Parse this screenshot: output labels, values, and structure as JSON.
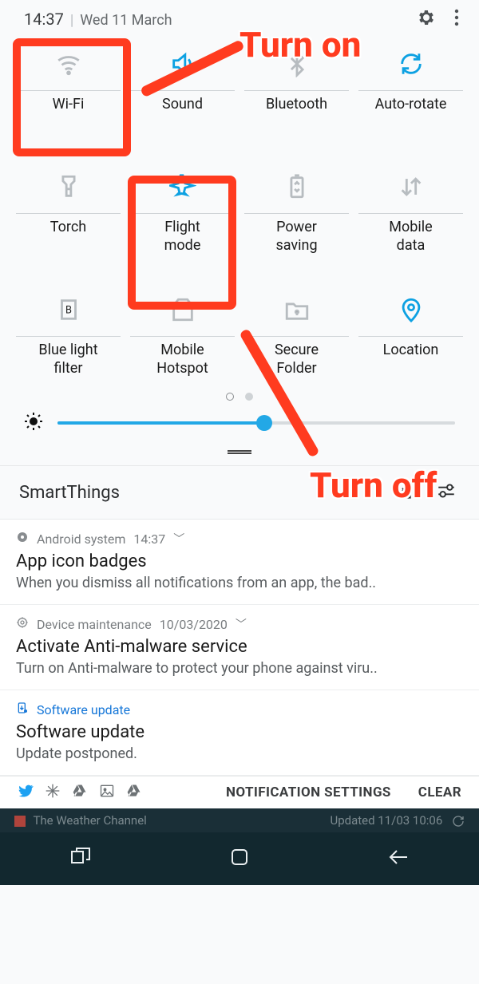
{
  "status": {
    "time": "14:37",
    "date": "Wed 11 March"
  },
  "tiles": [
    {
      "id": "wifi",
      "label": "Wi-Fi",
      "active": false,
      "icon": "wifi"
    },
    {
      "id": "sound",
      "label": "Sound",
      "active": true,
      "icon": "sound"
    },
    {
      "id": "bluetooth",
      "label": "Bluetooth",
      "active": false,
      "icon": "bluetooth"
    },
    {
      "id": "autorotate",
      "label": "Auto-rotate",
      "active": true,
      "icon": "rotate"
    },
    {
      "id": "torch",
      "label": "Torch",
      "active": false,
      "icon": "torch"
    },
    {
      "id": "flightmode",
      "label": "Flight\nmode",
      "active": true,
      "icon": "plane"
    },
    {
      "id": "powersaving",
      "label": "Power\nsaving",
      "active": false,
      "icon": "battery"
    },
    {
      "id": "mobiledata",
      "label": "Mobile\ndata",
      "active": false,
      "icon": "updown"
    },
    {
      "id": "bluelight",
      "label": "Blue light\nfilter",
      "active": false,
      "icon": "bfile"
    },
    {
      "id": "hotspot",
      "label": "Mobile\nHotspot",
      "active": false,
      "icon": "hotspot"
    },
    {
      "id": "securefolder",
      "label": "Secure\nFolder",
      "active": false,
      "icon": "folder"
    },
    {
      "id": "location",
      "label": "Location",
      "active": true,
      "icon": "pin"
    }
  ],
  "brightness_percent": 52,
  "smartthings_label": "SmartThings",
  "notifications": [
    {
      "app": "Android system",
      "time": "14:37",
      "title": "App icon badges",
      "body": "When you dismiss all notifications from an app, the bad..",
      "icon": "gear",
      "blue": false
    },
    {
      "app": "Device maintenance",
      "time": "10/03/2020",
      "title": "Activate Anti-malware service",
      "body": "Turn on Anti-malware to protect your phone against viru..",
      "icon": "target",
      "blue": false
    },
    {
      "app": "Software update",
      "time": "",
      "title": "Software update",
      "body": "Update postponed.",
      "icon": "download",
      "blue": true
    }
  ],
  "footer": {
    "settings": "NOTIFICATION SETTINGS",
    "clear": "CLEAR"
  },
  "weather": {
    "label": "The Weather Channel",
    "updated": "Updated  11/03  10:06"
  },
  "annotations": {
    "turn_on": "Turn on",
    "turn_off": "Turn off"
  }
}
